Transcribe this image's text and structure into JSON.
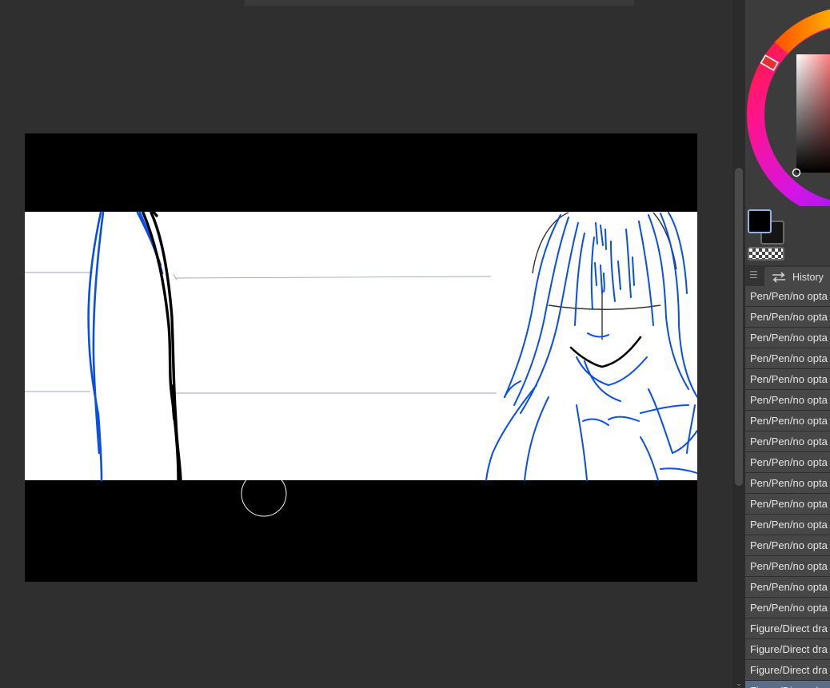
{
  "history": {
    "tab_label": "History",
    "items": [
      {
        "label": "Pen/Pen/no opta"
      },
      {
        "label": "Pen/Pen/no opta"
      },
      {
        "label": "Pen/Pen/no opta"
      },
      {
        "label": "Pen/Pen/no opta"
      },
      {
        "label": "Pen/Pen/no opta"
      },
      {
        "label": "Pen/Pen/no opta"
      },
      {
        "label": "Pen/Pen/no opta"
      },
      {
        "label": "Pen/Pen/no opta"
      },
      {
        "label": "Pen/Pen/no opta"
      },
      {
        "label": "Pen/Pen/no opta"
      },
      {
        "label": "Pen/Pen/no opta"
      },
      {
        "label": "Pen/Pen/no opta"
      },
      {
        "label": "Pen/Pen/no opta"
      },
      {
        "label": "Pen/Pen/no opta"
      },
      {
        "label": "Pen/Pen/no opta"
      },
      {
        "label": "Pen/Pen/no opta"
      },
      {
        "label": "Figure/Direct dra"
      },
      {
        "label": "Figure/Direct dra"
      },
      {
        "label": "Figure/Direct dra"
      },
      {
        "label": "Figure/Direct dra",
        "selected": true
      }
    ]
  },
  "colors": {
    "main_color": "#000000",
    "sub_color": "#151515",
    "stroke_blue": "#0a4ee8",
    "canvas_paper": "#ffffff",
    "letterbox": "#000000",
    "panel_bg": "#3c3c3c",
    "workspace_bg": "#2f2f2f"
  },
  "icons": {
    "panel_menu": "hamburger-menu-icon",
    "history_tab": "history-arrows-icon",
    "scroll_down": "chevron-down-icon",
    "brush_cursor": "circle-cursor"
  }
}
